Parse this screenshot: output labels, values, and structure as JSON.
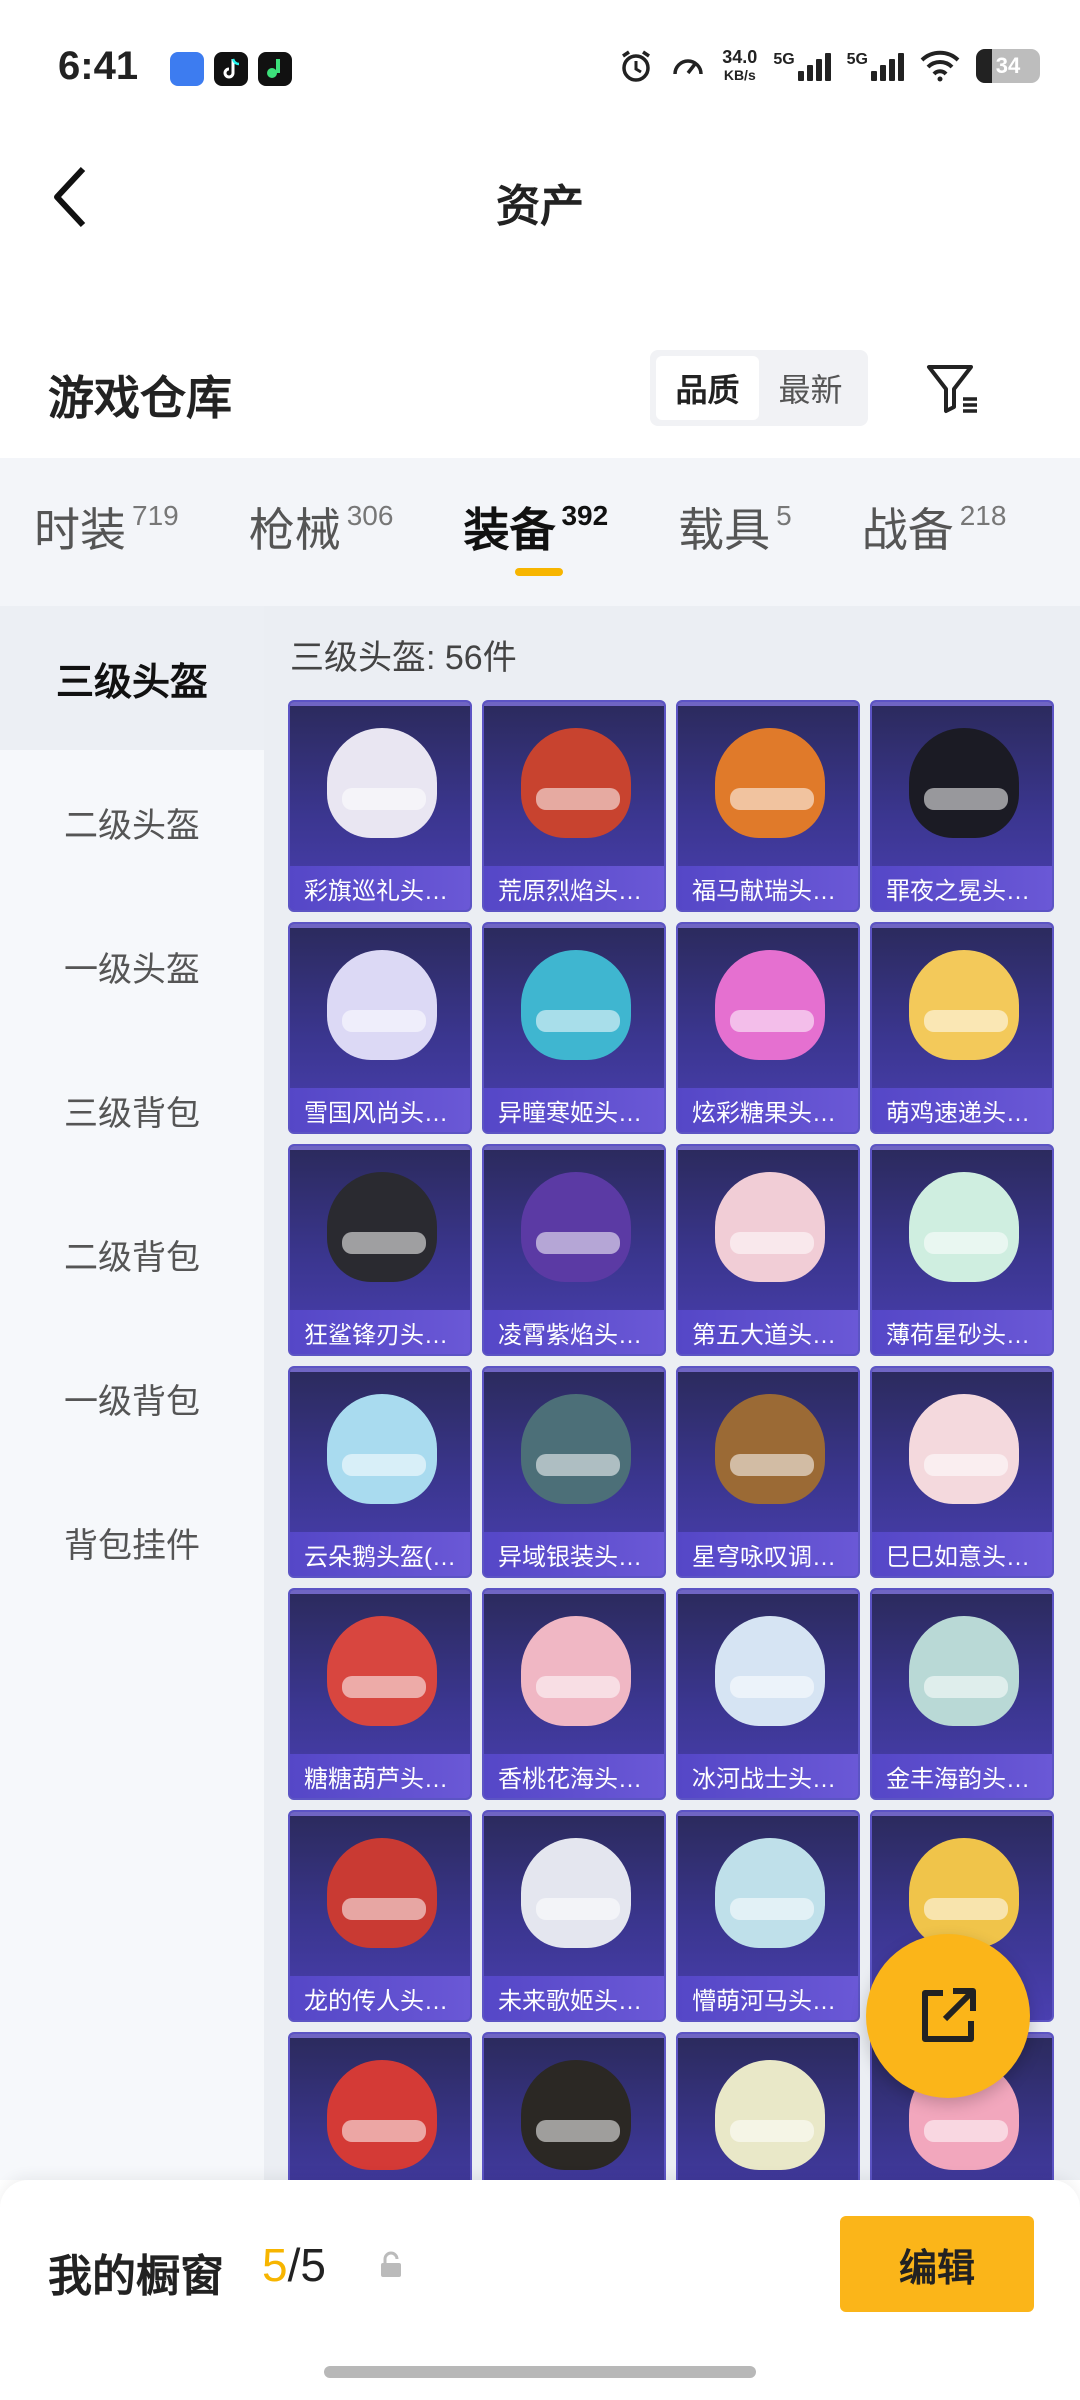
{
  "status_bar": {
    "time": "6:41",
    "net_speed_value": "34.0",
    "net_speed_unit": "KB/s",
    "sim1": "5G",
    "sim2": "5G",
    "battery": "34",
    "icons": [
      "message-app-icon",
      "tiktok-icon",
      "music-app-icon",
      "alarm-icon",
      "speedometer-icon",
      "signal-icon",
      "wifi-icon",
      "battery-icon"
    ]
  },
  "header": {
    "title": "资产"
  },
  "section": {
    "title": "游戏仓库",
    "sort_options": [
      "品质",
      "最新"
    ],
    "active_sort": "品质"
  },
  "tabs": [
    {
      "label": "时装",
      "count": "719",
      "active": false
    },
    {
      "label": "枪械",
      "count": "306",
      "active": false
    },
    {
      "label": "装备",
      "count": "392",
      "active": true
    },
    {
      "label": "载具",
      "count": "5",
      "active": false
    },
    {
      "label": "战备",
      "count": "218",
      "active": false
    }
  ],
  "sidebar": [
    {
      "label": "三级头盔",
      "active": true
    },
    {
      "label": "二级头盔",
      "active": false
    },
    {
      "label": "一级头盔",
      "active": false
    },
    {
      "label": "三级背包",
      "active": false
    },
    {
      "label": "二级背包",
      "active": false
    },
    {
      "label": "一级背包",
      "active": false
    },
    {
      "label": "背包挂件",
      "active": false
    }
  ],
  "grid": {
    "subtitle": "三级头盔: 56件",
    "items": [
      {
        "name": "彩旗巡礼头…",
        "color": "#e9e6f2"
      },
      {
        "name": "荒原烈焰头…",
        "color": "#c8432f"
      },
      {
        "name": "福马献瑞头…",
        "color": "#e07a2a"
      },
      {
        "name": "罪夜之冕头…",
        "color": "#1b1b24"
      },
      {
        "name": "雪国风尚头…",
        "color": "#dcd9f5"
      },
      {
        "name": "异瞳寒姬头…",
        "color": "#3fb6d0"
      },
      {
        "name": "炫彩糖果头…",
        "color": "#e570d0"
      },
      {
        "name": "萌鸡速递头…",
        "color": "#f3c95a"
      },
      {
        "name": "狂鲨锋刃头…",
        "color": "#2a2a30"
      },
      {
        "name": "凌霄紫焰头…",
        "color": "#5b3aa4"
      },
      {
        "name": "第五大道头…",
        "color": "#f1cdd6"
      },
      {
        "name": "薄荷星砂头…",
        "color": "#cfeee0"
      },
      {
        "name": "云朵鹅头盔(…",
        "color": "#a9dbef"
      },
      {
        "name": "异域银装头…",
        "color": "#4c6f78"
      },
      {
        "name": "星穹咏叹调…",
        "color": "#9b6a35"
      },
      {
        "name": "巳巳如意头…",
        "color": "#f4d9dd"
      },
      {
        "name": "糖糖葫芦头…",
        "color": "#d8463f"
      },
      {
        "name": "香桃花海头…",
        "color": "#f0b7c4"
      },
      {
        "name": "冰河战士头…",
        "color": "#d6e4f3"
      },
      {
        "name": "金丰海韵头…",
        "color": "#b9d9d6"
      },
      {
        "name": "龙的传人头…",
        "color": "#c93a33"
      },
      {
        "name": "未来歌姬头…",
        "color": "#e4e6ef"
      },
      {
        "name": "懵萌河马头…",
        "color": "#bfe0ea"
      },
      {
        "name": "",
        "color": "#f0c44a"
      },
      {
        "name": "",
        "color": "#d43a36"
      },
      {
        "name": "",
        "color": "#2b2824"
      },
      {
        "name": "",
        "color": "#e9e8c8"
      },
      {
        "name": "",
        "color": "#f2a7bd"
      }
    ]
  },
  "showcase": {
    "label": "我的橱窗",
    "current": "5",
    "separator": "/",
    "total": "5",
    "edit_label": "编辑"
  },
  "colors": {
    "accent": "#f7b500",
    "card": "#3b3690"
  }
}
